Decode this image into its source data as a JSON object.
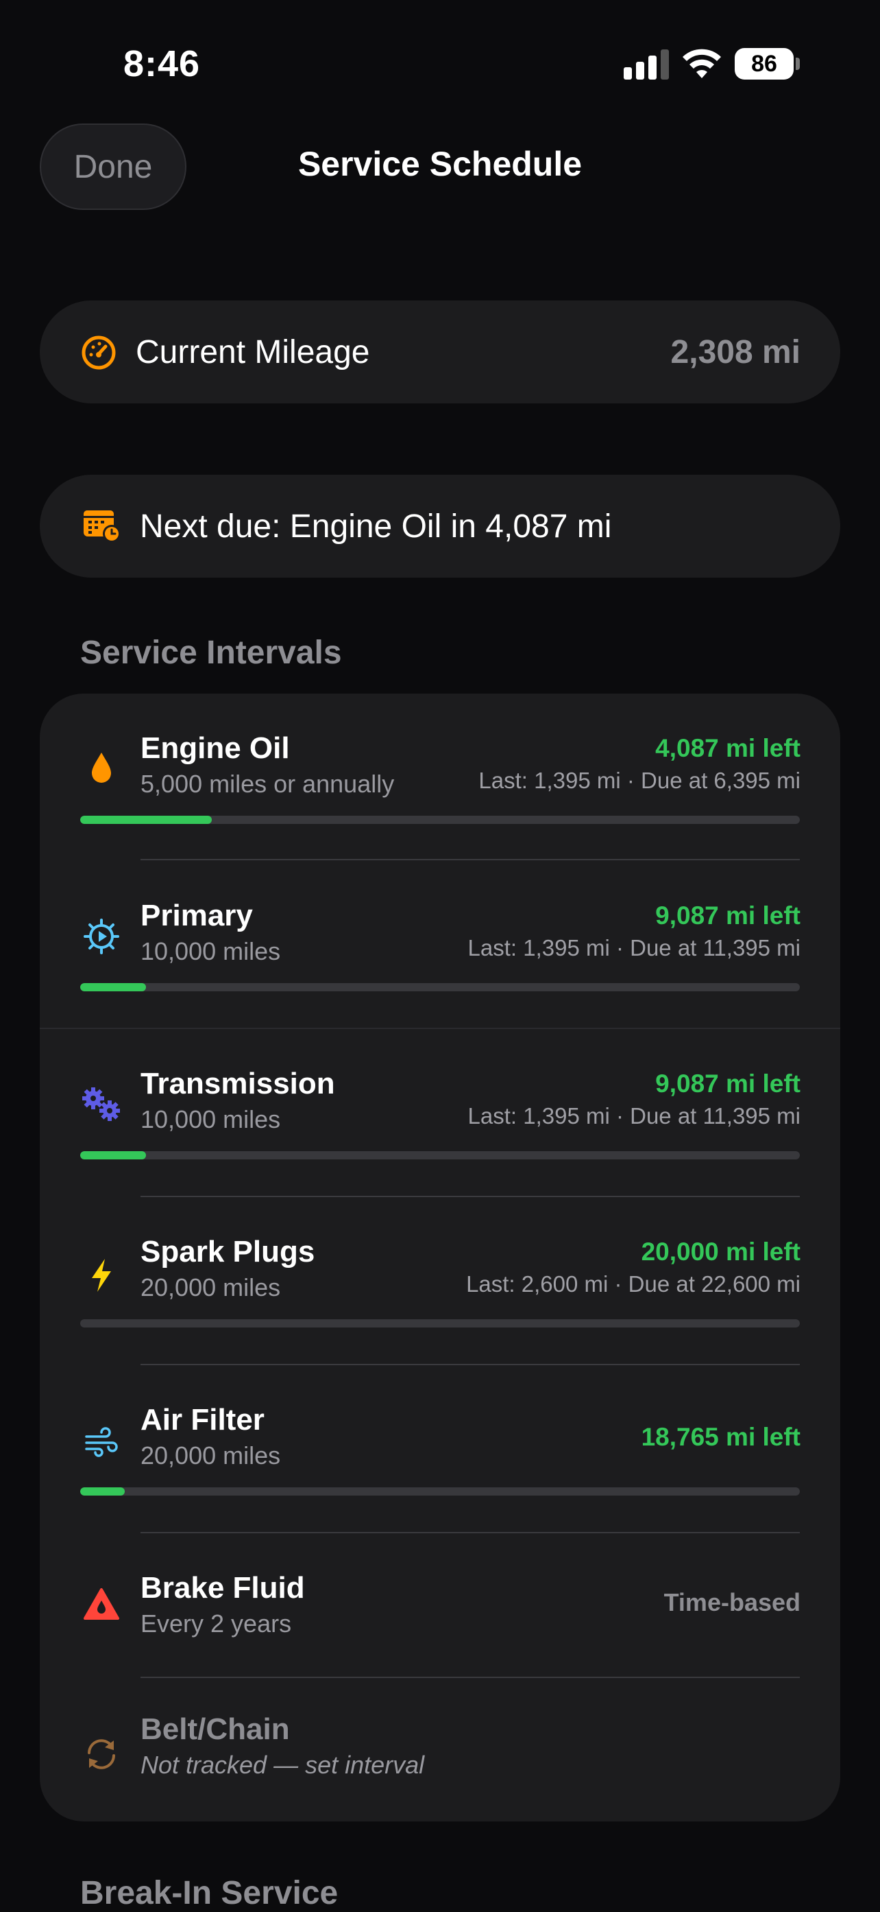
{
  "status_bar": {
    "time": "8:46",
    "battery": "86"
  },
  "nav": {
    "done_label": "Done",
    "title": "Service Schedule"
  },
  "mileage": {
    "icon": "gauge-icon",
    "label": "Current Mileage",
    "value": "2,308 mi"
  },
  "next_due": {
    "icon": "calendar-clock-icon",
    "text": "Next due: Engine Oil in 4,087 mi"
  },
  "sections": {
    "intervals": "Service Intervals",
    "break_in": "Break-In Service"
  },
  "colors": {
    "accent_orange": "#ff9500",
    "green": "#34c759",
    "red": "#ff453a",
    "indigo": "#5e5ce6",
    "teal": "#5ac8fa",
    "yellow": "#ffd60a"
  },
  "intervals": [
    {
      "name": "Engine Oil",
      "interval": "5,000 miles or annually",
      "remaining": "4,087 mi left",
      "detail": "Last: 1,395 mi · Due at 6,395 mi",
      "progress": 0.183,
      "icon": "oil-drop-icon"
    },
    {
      "name": "Primary",
      "interval": "10,000 miles",
      "remaining": "9,087 mi left",
      "detail": "Last: 1,395 mi · Due at 11,395 mi",
      "progress": 0.091,
      "icon": "gear-icon"
    },
    {
      "name": "Transmission",
      "interval": "10,000 miles",
      "remaining": "9,087 mi left",
      "detail": "Last: 1,395 mi · Due at 11,395 mi",
      "progress": 0.091,
      "icon": "gears-icon"
    },
    {
      "name": "Spark Plugs",
      "interval": "20,000 miles",
      "remaining": "20,000 mi left",
      "detail": "Last: 2,600 mi · Due at 22,600 mi",
      "progress": 0.0,
      "icon": "bolt-icon"
    },
    {
      "name": "Air Filter",
      "interval": "20,000 miles",
      "remaining": "18,765 mi left",
      "progress": 0.062,
      "icon": "wind-icon"
    },
    {
      "name": "Brake Fluid",
      "interval": "Every 2 years",
      "status": "Time-based",
      "icon": "warning-drop-icon"
    },
    {
      "name": "Belt/Chain",
      "interval": "Not tracked — set interval",
      "icon": "cycle-arrows-icon"
    }
  ]
}
